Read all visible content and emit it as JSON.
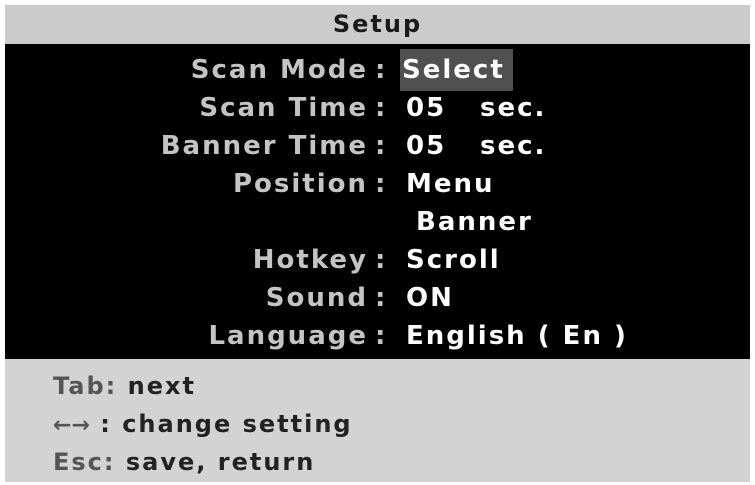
{
  "header": {
    "title": "Setup"
  },
  "settings": {
    "scan_mode": {
      "label": "Scan Mode",
      "value": "Select"
    },
    "scan_time": {
      "label": "Scan Time",
      "value": "05",
      "unit": "sec."
    },
    "banner_time": {
      "label": "Banner Time",
      "value": "05",
      "unit": "sec."
    },
    "position": {
      "label": "Position",
      "value": "Menu",
      "value_2": "Banner"
    },
    "hotkey": {
      "label": "Hotkey",
      "value": "Scroll"
    },
    "sound": {
      "label": "Sound",
      "value": "ON"
    },
    "language": {
      "label": "Language",
      "value": "English ( En )"
    },
    "separator": ":"
  },
  "help": {
    "tab": {
      "key": "Tab:",
      "text": "next"
    },
    "arrows": {
      "key": "←→",
      "text": ": change setting"
    },
    "esc": {
      "key": "Esc:",
      "text": "save, return"
    }
  },
  "colors": {
    "title_bg": "#cbcbcb",
    "menu_bg": "#000000",
    "footer_bg": "#d3d3d3",
    "selected_bg": "#505050",
    "label_text": "#c4c4c4",
    "value_text": "#ffffff"
  }
}
